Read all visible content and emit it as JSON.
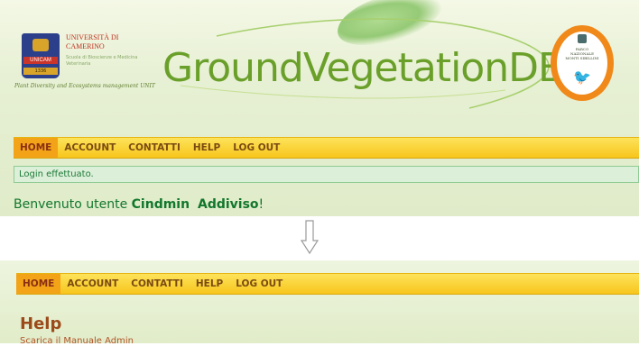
{
  "top": {
    "university": {
      "title": "UNIVERSITÀ DI CAMERINO",
      "shield_label": "UNICAM",
      "shield_year": "1336",
      "subtitle": "Scuola di Bioscienze e Medicina Veterinaria",
      "motto": "Plant Diversity and Ecosystems management UNIT"
    },
    "brand": "GroundVegetationDB",
    "park_text": "PARCO NAZIONALE MONTI SIBILLINI"
  },
  "nav1": {
    "items": [
      {
        "label": "HOME",
        "active": true
      },
      {
        "label": "ACCOUNT",
        "active": false
      },
      {
        "label": "CONTATTI",
        "active": false
      },
      {
        "label": "HELP",
        "active": false
      },
      {
        "label": "LOG OUT",
        "active": false
      }
    ]
  },
  "status": {
    "message": "Login effettuato."
  },
  "welcome": {
    "prefix": "Benvenuto utente ",
    "first": "Cindmin",
    "last": "Addiviso",
    "suffix": "!"
  },
  "nav2": {
    "items": [
      {
        "label": "HOME",
        "active": true
      },
      {
        "label": "ACCOUNT",
        "active": false
      },
      {
        "label": "CONTATTI",
        "active": false
      },
      {
        "label": "HELP",
        "active": false
      },
      {
        "label": "LOG OUT",
        "active": false
      }
    ]
  },
  "help": {
    "title": "Help",
    "link": "Scarica il Manuale Admin"
  },
  "colors": {
    "nav_bg": "#f7c51c",
    "nav_active": "#f3a318",
    "success": "#1e7b3a",
    "brand": "#6aa02a"
  },
  "icons": {
    "transition": "down-arrow-icon",
    "park": "park-logo-icon",
    "university": "university-shield-icon"
  }
}
